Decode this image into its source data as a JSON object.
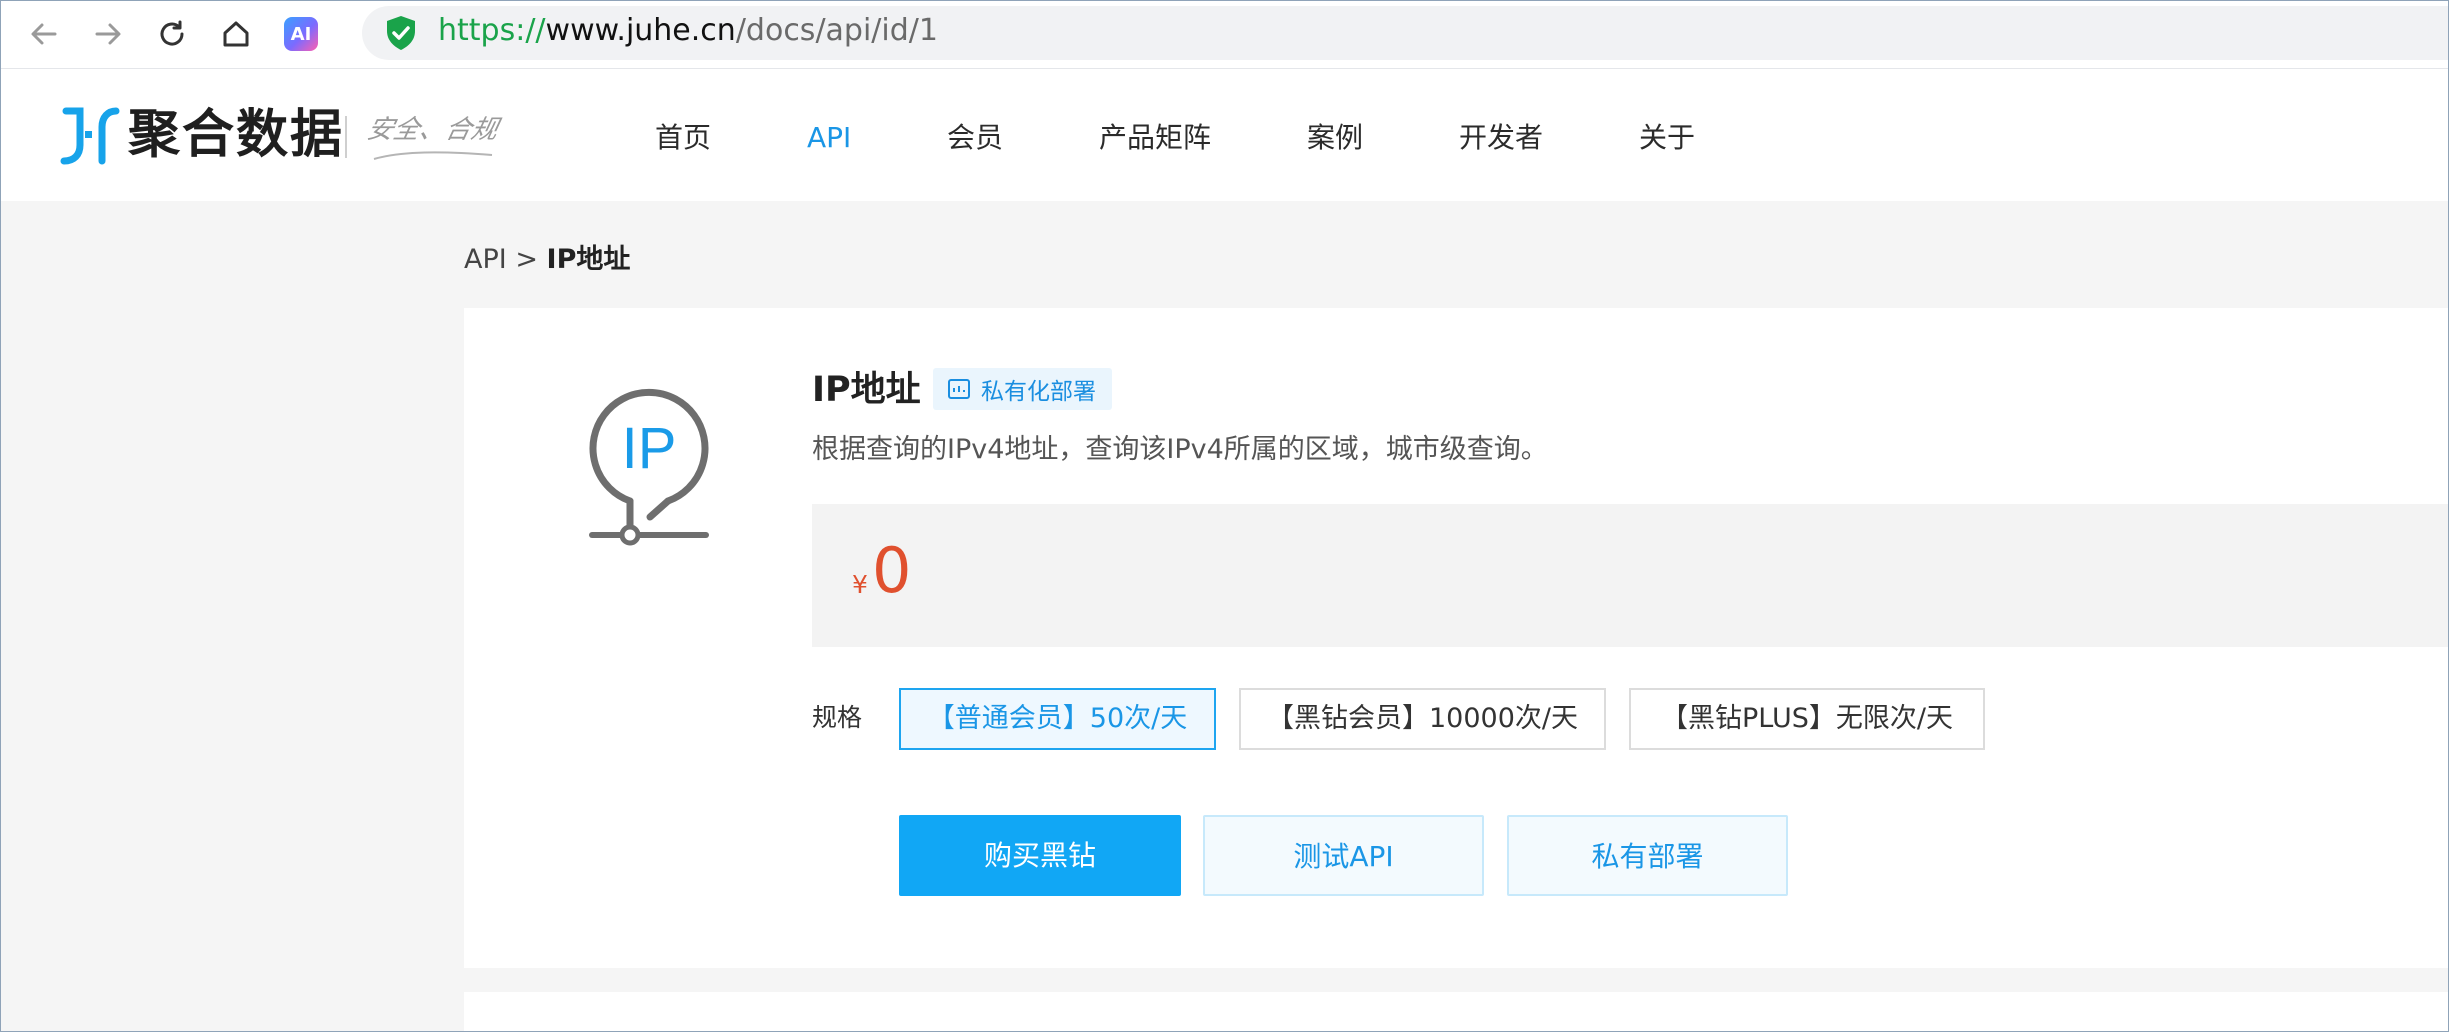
{
  "browser": {
    "url_protocol": "https://",
    "url_host": "www.juhe.cn",
    "url_path": "/docs/api/id/1",
    "ai_button_label": "AI",
    "icons": [
      "back-arrow-icon",
      "forward-arrow-icon",
      "reload-icon",
      "home-icon",
      "shield-check-icon"
    ]
  },
  "header": {
    "logo_text": "聚合数据",
    "slogan": "安全、合规",
    "nav": [
      "首页",
      "API",
      "会员",
      "产品矩阵",
      "案例",
      "开发者",
      "关于"
    ],
    "active_nav": "API"
  },
  "breadcrumb": {
    "root": "API",
    "separator": ">",
    "current": "IP地址"
  },
  "api": {
    "title": "IP地址",
    "badge": "私有化部署",
    "description": "根据查询的IPv4地址，查询该IPv4所属的区域，城市级查询。",
    "icon_text": "IP",
    "price_currency": "¥",
    "price_value": "0",
    "spec_label": "规格",
    "specs": [
      {
        "label": "【普通会员】50次/天",
        "selected": true
      },
      {
        "label": "【黑钻会员】10000次/天",
        "selected": false
      },
      {
        "label": "【黑钻PLUS】无限次/天",
        "selected": false
      }
    ],
    "buttons": {
      "buy": "购买黑钻",
      "test": "测试API",
      "private": "私有部署"
    }
  },
  "colors": {
    "accent": "#11a7f5",
    "price": "#e0502e",
    "secure": "#1aa34a"
  }
}
